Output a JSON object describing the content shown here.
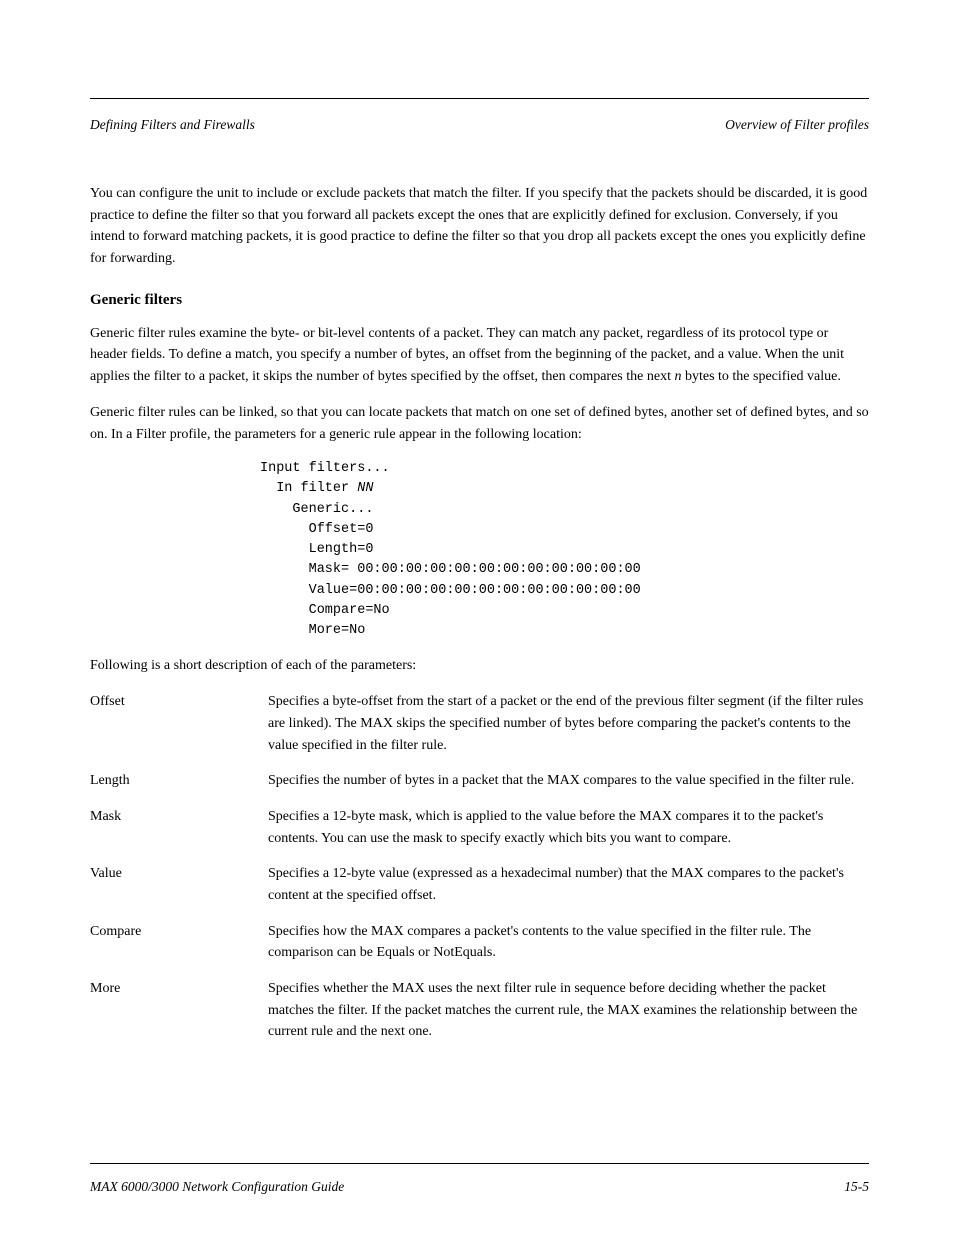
{
  "header": {
    "left": "Defining Filters and Firewalls",
    "right": "Overview of Filter profiles"
  },
  "para1": "You can configure the unit to include or exclude packets that match the filter. If you specify that the packets should be discarded, it is good practice to define the filter so that you forward all packets except the ones that are explicitly defined for exclusion. Conversely, if you intend to forward matching packets, it is good practice to define the filter so that you drop all packets except the ones you explicitly define for forwarding.",
  "section_heading": "Generic filters",
  "para2_prefix": "Generic filter rules examine the byte- or bit-level contents of a packet. They can match any packet, regardless of its protocol type or header fields. To define a match, you specify a number of bytes, an offset from the beginning of the packet, and a value. When the unit applies the filter to a packet, it skips the number of bytes specified by the offset, then compares the next ",
  "para2_emph": "n",
  "para2_suffix": " bytes to the specified value.",
  "para3": "Generic filter rules can be linked, so that you can locate packets that match on one set of defined bytes, another set of defined bytes, and so on. In a Filter profile, the parameters for a generic rule appear in the following location:",
  "code": {
    "l1": "Input filters...",
    "l2": "  In filter ",
    "l2_var": "NN",
    "l3": "    Generic...",
    "l4": "      Offset=0",
    "l5": "      Length=0",
    "l6": "      Mask= 00:00:00:00:00:00:00:00:00:00:00:00",
    "l7": "      Value=00:00:00:00:00:00:00:00:00:00:00:00",
    "l8": "      Compare=No",
    "l9": "      More=No"
  },
  "para4": "Following is a short description of each of the parameters:",
  "desc": [
    {
      "term": "Offset",
      "def": "Specifies a byte-offset from the start of a packet or the end of the previous filter segment (if the filter rules are linked). The MAX skips the specified number of bytes before comparing the packet's contents to the value specified in the filter rule."
    },
    {
      "term": "Length",
      "def": "Specifies the number of bytes in a packet that the MAX compares to the value specified in the filter rule."
    },
    {
      "term": "Mask",
      "def": "Specifies a 12-byte mask, which is applied to the value before the MAX compares it to the packet's contents. You can use the mask to specify exactly which bits you want to compare."
    },
    {
      "term": "Value",
      "def": "Specifies a 12-byte value (expressed as a hexadecimal number) that the MAX compares to the packet's content at the specified offset."
    },
    {
      "term": "Compare",
      "def": "Specifies how the MAX compares a packet's contents to the value specified in the filter rule. The comparison can be Equals or NotEquals."
    },
    {
      "term": "More",
      "def": "Specifies whether the MAX uses the next filter rule in sequence before deciding whether the packet matches the filter. If the packet matches the current rule, the MAX examines the relationship between the current rule and the next one."
    }
  ],
  "footer": {
    "left": "MAX 6000/3000 Network Configuration Guide",
    "right": "15-5"
  }
}
